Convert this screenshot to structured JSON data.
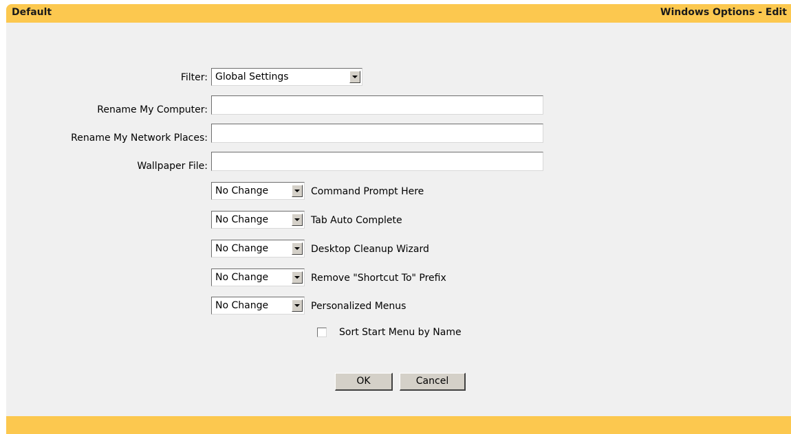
{
  "header": {
    "left_title": "Default",
    "right_title": "Windows Options - Edit"
  },
  "form": {
    "filter_label": "Filter:",
    "filter_value": "Global Settings",
    "rename_computer_label": "Rename My Computer:",
    "rename_computer_value": "",
    "rename_network_label": "Rename My Network Places:",
    "rename_network_value": "",
    "wallpaper_label": "Wallpaper File:",
    "wallpaper_value": "",
    "options": [
      {
        "value": "No Change",
        "label": "Command Prompt Here"
      },
      {
        "value": "No Change",
        "label": "Tab Auto Complete"
      },
      {
        "value": "No Change",
        "label": "Desktop Cleanup Wizard"
      },
      {
        "value": "No Change",
        "label": "Remove \"Shortcut To\" Prefix"
      },
      {
        "value": "No Change",
        "label": "Personalized Menus"
      }
    ],
    "sort_start_menu_label": "Sort Start Menu by Name",
    "sort_start_menu_checked": false
  },
  "buttons": {
    "ok": "OK",
    "cancel": "Cancel"
  },
  "colors": {
    "header_bar": "#fcc84f",
    "panel_background": "#f0f0f0",
    "button_face": "#d4d0c8"
  }
}
